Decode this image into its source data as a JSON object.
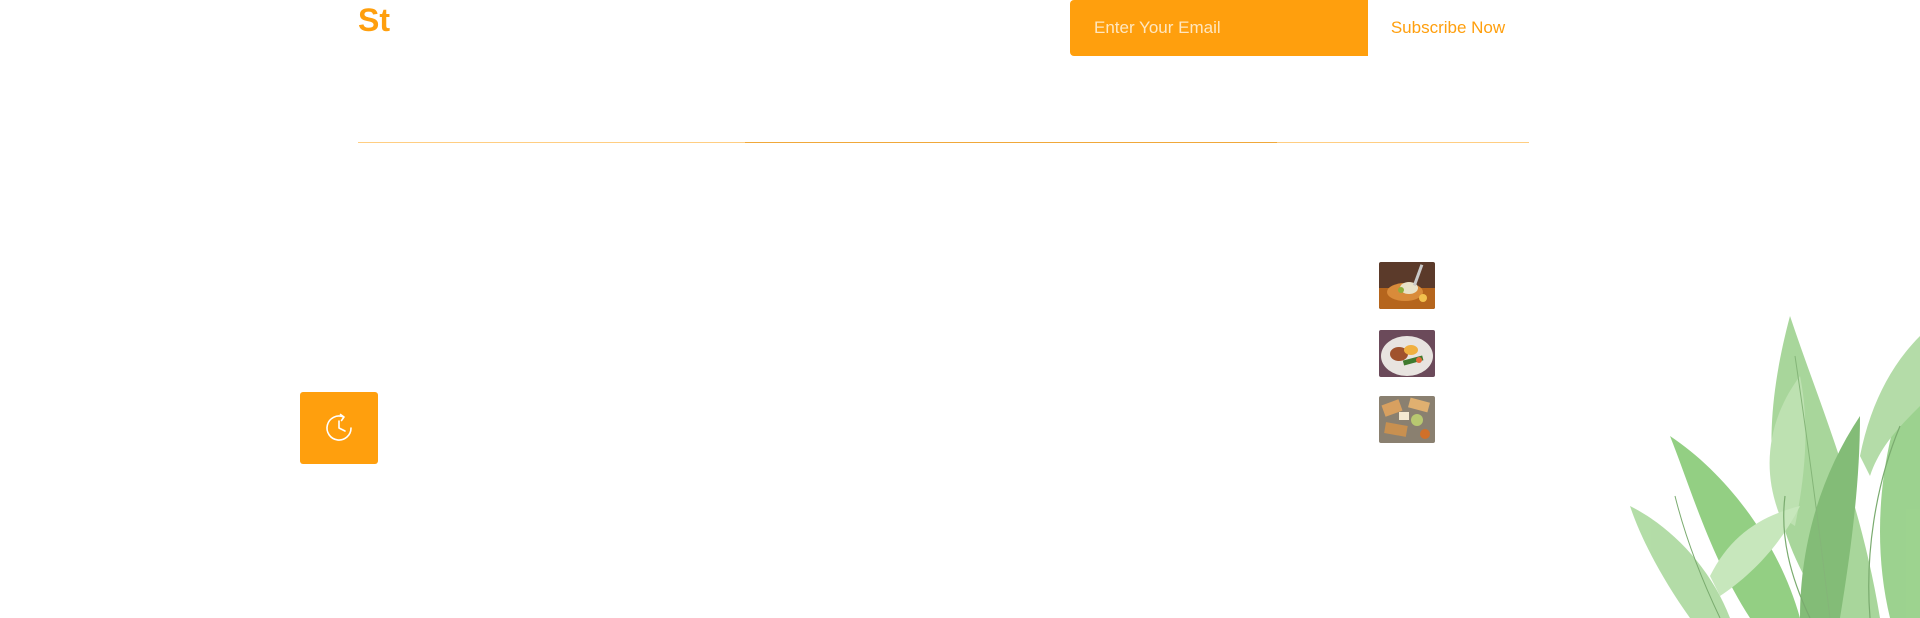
{
  "header": {
    "brand": "St"
  },
  "newsletter": {
    "email_placeholder": "Enter Your Email",
    "subscribe_label": "Subscribe Now"
  },
  "colors": {
    "accent": "#ff9f0d",
    "divider": "#ffce82",
    "leaf_green": "#6fbf5a"
  },
  "icons": {
    "floating_button": "history-icon",
    "decoration": "leaves-decoration"
  },
  "thumbnails": [
    {
      "name": "food-thumbnail-1"
    },
    {
      "name": "food-thumbnail-2"
    },
    {
      "name": "food-thumbnail-3"
    }
  ]
}
